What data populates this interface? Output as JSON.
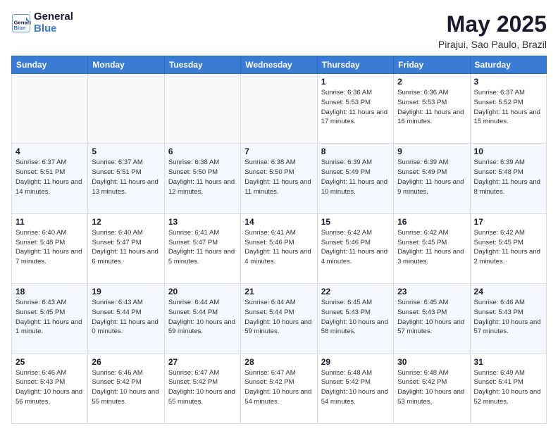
{
  "header": {
    "logo_general": "General",
    "logo_blue": "Blue",
    "month_title": "May 2025",
    "location": "Pirajui, Sao Paulo, Brazil"
  },
  "days_of_week": [
    "Sunday",
    "Monday",
    "Tuesday",
    "Wednesday",
    "Thursday",
    "Friday",
    "Saturday"
  ],
  "weeks": [
    [
      {
        "day": "",
        "empty": true
      },
      {
        "day": "",
        "empty": true
      },
      {
        "day": "",
        "empty": true
      },
      {
        "day": "",
        "empty": true
      },
      {
        "day": "1",
        "sunrise": "6:36 AM",
        "sunset": "5:53 PM",
        "daylight": "11 hours and 17 minutes."
      },
      {
        "day": "2",
        "sunrise": "6:36 AM",
        "sunset": "5:53 PM",
        "daylight": "11 hours and 16 minutes."
      },
      {
        "day": "3",
        "sunrise": "6:37 AM",
        "sunset": "5:52 PM",
        "daylight": "11 hours and 15 minutes."
      }
    ],
    [
      {
        "day": "4",
        "sunrise": "6:37 AM",
        "sunset": "5:51 PM",
        "daylight": "11 hours and 14 minutes."
      },
      {
        "day": "5",
        "sunrise": "6:37 AM",
        "sunset": "5:51 PM",
        "daylight": "11 hours and 13 minutes."
      },
      {
        "day": "6",
        "sunrise": "6:38 AM",
        "sunset": "5:50 PM",
        "daylight": "11 hours and 12 minutes."
      },
      {
        "day": "7",
        "sunrise": "6:38 AM",
        "sunset": "5:50 PM",
        "daylight": "11 hours and 11 minutes."
      },
      {
        "day": "8",
        "sunrise": "6:39 AM",
        "sunset": "5:49 PM",
        "daylight": "11 hours and 10 minutes."
      },
      {
        "day": "9",
        "sunrise": "6:39 AM",
        "sunset": "5:49 PM",
        "daylight": "11 hours and 9 minutes."
      },
      {
        "day": "10",
        "sunrise": "6:39 AM",
        "sunset": "5:48 PM",
        "daylight": "11 hours and 8 minutes."
      }
    ],
    [
      {
        "day": "11",
        "sunrise": "6:40 AM",
        "sunset": "5:48 PM",
        "daylight": "11 hours and 7 minutes."
      },
      {
        "day": "12",
        "sunrise": "6:40 AM",
        "sunset": "5:47 PM",
        "daylight": "11 hours and 6 minutes."
      },
      {
        "day": "13",
        "sunrise": "6:41 AM",
        "sunset": "5:47 PM",
        "daylight": "11 hours and 5 minutes."
      },
      {
        "day": "14",
        "sunrise": "6:41 AM",
        "sunset": "5:46 PM",
        "daylight": "11 hours and 4 minutes."
      },
      {
        "day": "15",
        "sunrise": "6:42 AM",
        "sunset": "5:46 PM",
        "daylight": "11 hours and 4 minutes."
      },
      {
        "day": "16",
        "sunrise": "6:42 AM",
        "sunset": "5:45 PM",
        "daylight": "11 hours and 3 minutes."
      },
      {
        "day": "17",
        "sunrise": "6:42 AM",
        "sunset": "5:45 PM",
        "daylight": "11 hours and 2 minutes."
      }
    ],
    [
      {
        "day": "18",
        "sunrise": "6:43 AM",
        "sunset": "5:45 PM",
        "daylight": "11 hours and 1 minute."
      },
      {
        "day": "19",
        "sunrise": "6:43 AM",
        "sunset": "5:44 PM",
        "daylight": "11 hours and 0 minutes."
      },
      {
        "day": "20",
        "sunrise": "6:44 AM",
        "sunset": "5:44 PM",
        "daylight": "10 hours and 59 minutes."
      },
      {
        "day": "21",
        "sunrise": "6:44 AM",
        "sunset": "5:44 PM",
        "daylight": "10 hours and 59 minutes."
      },
      {
        "day": "22",
        "sunrise": "6:45 AM",
        "sunset": "5:43 PM",
        "daylight": "10 hours and 58 minutes."
      },
      {
        "day": "23",
        "sunrise": "6:45 AM",
        "sunset": "5:43 PM",
        "daylight": "10 hours and 57 minutes."
      },
      {
        "day": "24",
        "sunrise": "6:46 AM",
        "sunset": "5:43 PM",
        "daylight": "10 hours and 57 minutes."
      }
    ],
    [
      {
        "day": "25",
        "sunrise": "6:46 AM",
        "sunset": "5:43 PM",
        "daylight": "10 hours and 56 minutes."
      },
      {
        "day": "26",
        "sunrise": "6:46 AM",
        "sunset": "5:42 PM",
        "daylight": "10 hours and 55 minutes."
      },
      {
        "day": "27",
        "sunrise": "6:47 AM",
        "sunset": "5:42 PM",
        "daylight": "10 hours and 55 minutes."
      },
      {
        "day": "28",
        "sunrise": "6:47 AM",
        "sunset": "5:42 PM",
        "daylight": "10 hours and 54 minutes."
      },
      {
        "day": "29",
        "sunrise": "6:48 AM",
        "sunset": "5:42 PM",
        "daylight": "10 hours and 54 minutes."
      },
      {
        "day": "30",
        "sunrise": "6:48 AM",
        "sunset": "5:42 PM",
        "daylight": "10 hours and 53 minutes."
      },
      {
        "day": "31",
        "sunrise": "6:49 AM",
        "sunset": "5:41 PM",
        "daylight": "10 hours and 52 minutes."
      }
    ]
  ]
}
